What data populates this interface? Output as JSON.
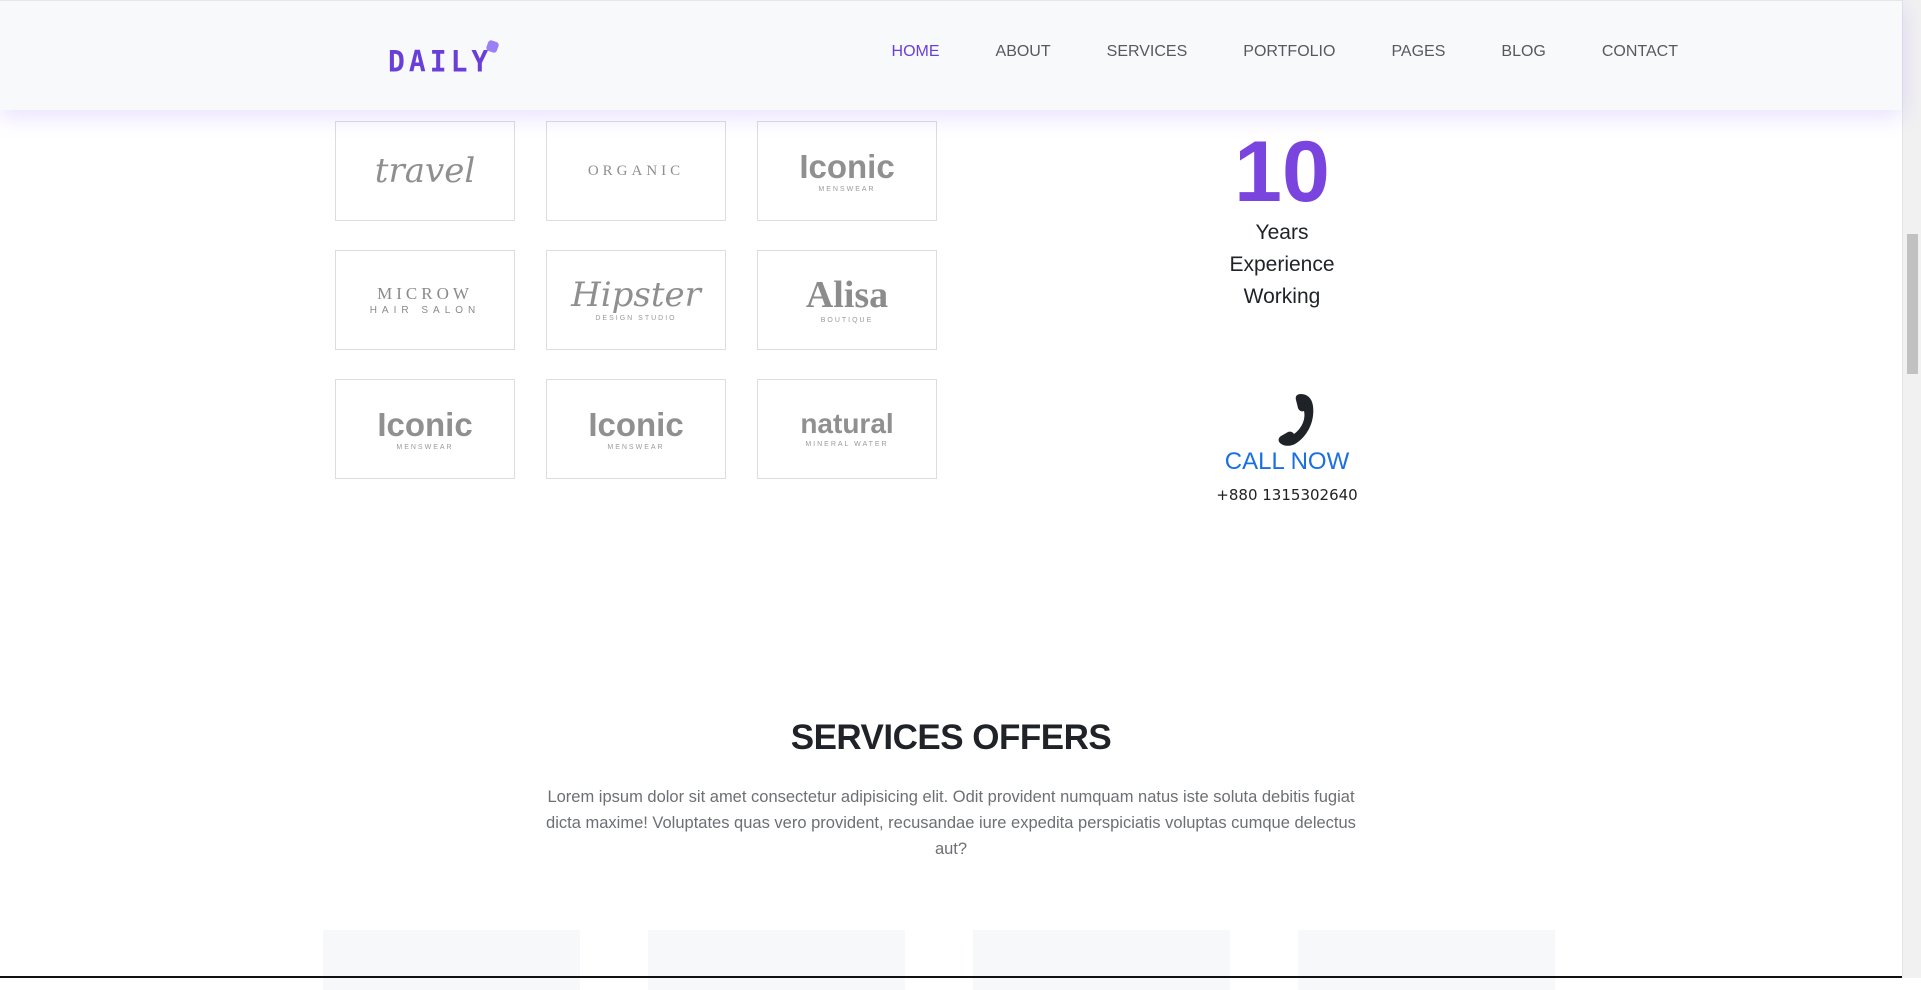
{
  "header": {
    "logo_text": "DAILY",
    "nav": [
      {
        "label": "HOME",
        "active": true
      },
      {
        "label": "ABOUT",
        "active": false
      },
      {
        "label": "SERVICES",
        "active": false
      },
      {
        "label": "PORTFOLIO",
        "active": false
      },
      {
        "label": "PAGES",
        "active": false
      },
      {
        "label": "BLOG",
        "active": false
      },
      {
        "label": "CONTACT",
        "active": false
      }
    ]
  },
  "brand_logos": [
    {
      "main": "travel",
      "sub": "",
      "style": "script"
    },
    {
      "main": "ORGANIC",
      "sub": "",
      "style": "serif-caps"
    },
    {
      "main": "Iconic",
      "sub": "MENSWEAR",
      "style": "bold"
    },
    {
      "main": "MICROW",
      "sub": "HAIR SALON",
      "style": "serif-wide"
    },
    {
      "main": "Hipster",
      "sub": "DESIGN STUDIO",
      "style": "script"
    },
    {
      "main": "Alisa",
      "sub": "BOUTIQUE",
      "style": "serif-bold"
    },
    {
      "main": "Iconic",
      "sub": "MENSWEAR",
      "style": "bold"
    },
    {
      "main": "Iconic",
      "sub": "MENSWEAR",
      "style": "bold"
    },
    {
      "main": "natural",
      "sub": "MINERAL WATER",
      "style": "bold"
    }
  ],
  "experience": {
    "number": "10",
    "line1": "Years",
    "line2": "Experience",
    "line3": "Working"
  },
  "call": {
    "icon": "phone-icon",
    "label": "CALL NOW",
    "number": "+880 1315302640"
  },
  "services": {
    "title": "SERVICES OFFERS",
    "description": "Lorem ipsum dolor sit amet consectetur adipisicing elit. Odit provident numquam natus iste soluta debitis fugiat dicta maxime! Voluptates quas vero provident, recusandae iure expedita perspiciatis voluptas cumque delectus aut?"
  },
  "colors": {
    "accent": "#6a3fd8",
    "number": "#7a45de",
    "link": "#1a6fe3",
    "text": "#1f2328",
    "muted": "#6c6f73"
  }
}
